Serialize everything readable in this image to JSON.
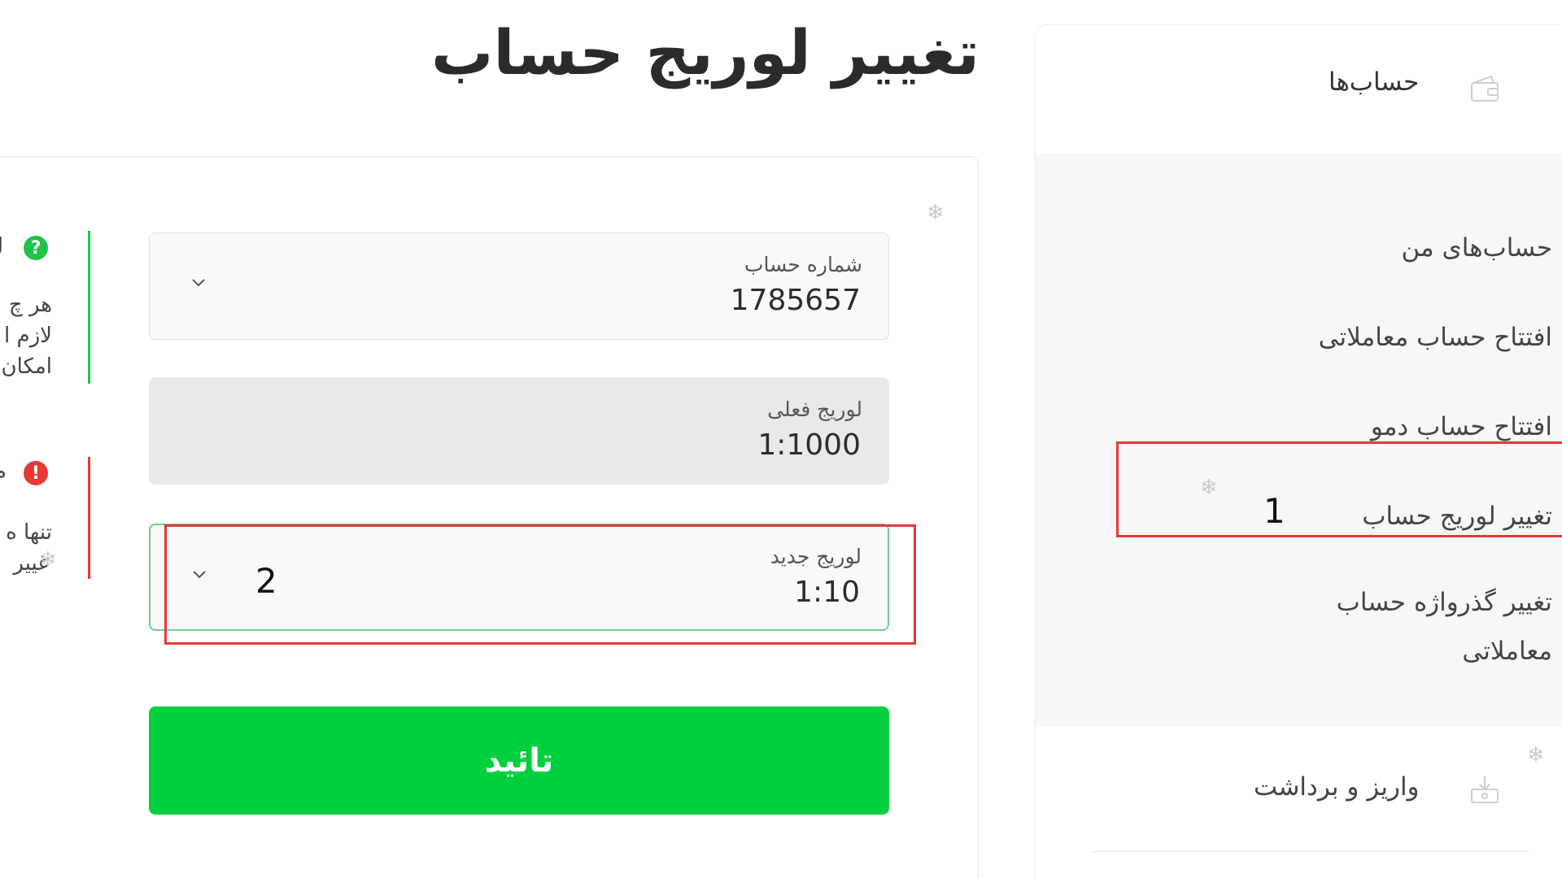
{
  "sidebar": {
    "accounts_header": "حساب‌ها",
    "items": [
      {
        "label": "حساب‌های من"
      },
      {
        "label": "افتتاح حساب معاملاتی"
      },
      {
        "label": "افتتاح حساب دمو"
      },
      {
        "label": "تغییر لوریج حساب"
      },
      {
        "label": "تغییر گذرواژه حساب معاملاتی"
      }
    ],
    "deposit_header": "واریز و برداشت"
  },
  "annotations": {
    "one": "1",
    "two": "2"
  },
  "page": {
    "title": "تغییر لوریج حساب"
  },
  "form": {
    "account_number": {
      "label": "شماره حساب",
      "value": "1785657"
    },
    "current_leverage": {
      "label": "لوریج فعلی",
      "value": "1:1000"
    },
    "new_leverage": {
      "label": "لوریج جدید",
      "value": "1:10"
    },
    "submit_label": "تائید"
  },
  "info": {
    "help_icon": "?",
    "help_title": "ل",
    "help_lines": [
      "هر چ",
      "لازم ا",
      "امکان"
    ],
    "warn_icon": "!",
    "warn_title": "م",
    "warn_lines": [
      "تنها ه",
      "غییر"
    ]
  },
  "colors": {
    "accent_green": "#00d03e",
    "annotation_red": "#e53935"
  }
}
